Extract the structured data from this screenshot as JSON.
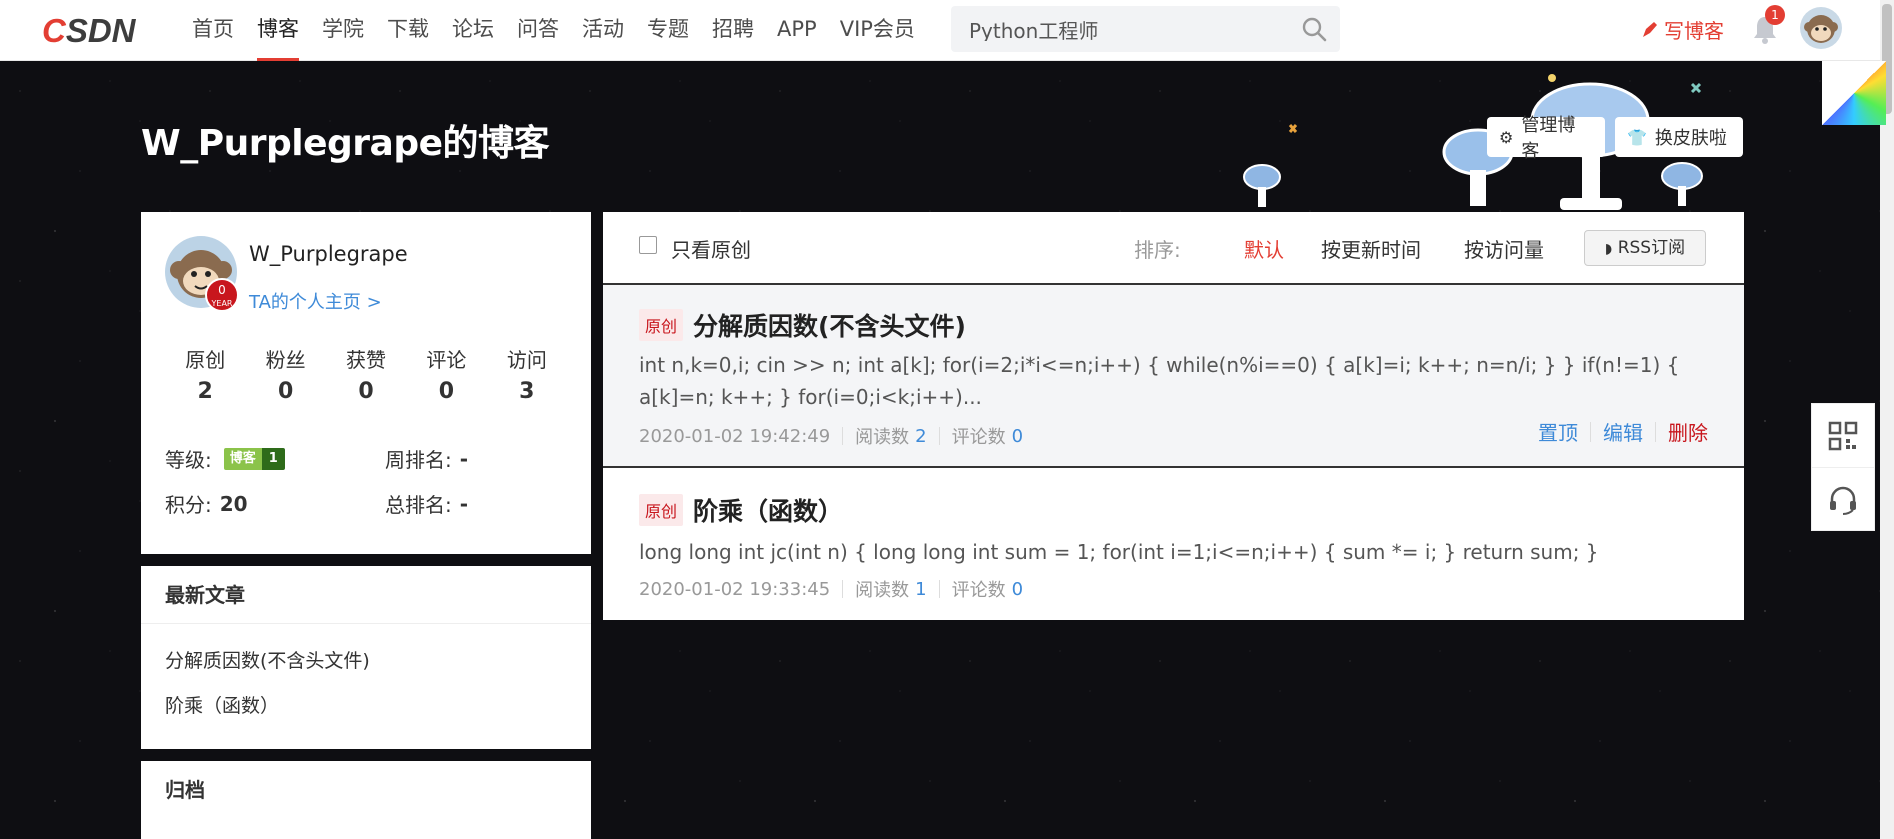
{
  "topbar": {
    "logo_text_red": "C",
    "logo_text_dark": "SDN",
    "nav": [
      "首页",
      "博客",
      "学院",
      "下载",
      "论坛",
      "问答",
      "活动",
      "专题",
      "招聘",
      "APP",
      "VIP会员"
    ],
    "active_nav": "博客",
    "search_value": "Python工程师",
    "write_blog_label": "写博客",
    "notification_count": "1"
  },
  "banner": {
    "blog_title": "W_Purplegrape的博客",
    "manage_label": "管理博客",
    "skin_label": "换皮肤啦"
  },
  "profile": {
    "name": "W_Purplegrape",
    "homepage_link": "TA的个人主页 >",
    "year_badge": "0",
    "year_badge_sub": "YEAR",
    "stats": [
      {
        "label": "原创",
        "value": "2"
      },
      {
        "label": "粉丝",
        "value": "0"
      },
      {
        "label": "获赞",
        "value": "0"
      },
      {
        "label": "评论",
        "value": "0"
      },
      {
        "label": "访问",
        "value": "3"
      }
    ],
    "level_label": "等级:",
    "level_badge_text": "博客",
    "level_badge_num": "1",
    "points_label": "积分:",
    "points_value": "20",
    "week_rank_label": "周排名:",
    "week_rank_value": "-",
    "total_rank_label": "总排名:",
    "total_rank_value": "-"
  },
  "recent": {
    "heading": "最新文章",
    "items": [
      "分解质因数(不含头文件)",
      "阶乘（函数）"
    ]
  },
  "archive": {
    "heading": "归档"
  },
  "filter": {
    "only_original_label": "只看原创",
    "sort_label": "排序:",
    "sort_options": [
      "默认",
      "按更新时间",
      "按访问量"
    ],
    "active_sort": "默认",
    "rss_label": "RSS订阅"
  },
  "articles": [
    {
      "tag": "原创",
      "title": "分解质因数(不含头文件)",
      "desc": "int n,k=0,i; cin >> n; int a[k]; for(i=2;i*i<=n;i++) { while(n%i==0) { a[k]=i; k++; n=n/i; } } if(n!=1) { a[k]=n; k++; } for(i=0;i<k;i++)...",
      "date": "2020-01-02 19:42:49",
      "reads_label": "阅读数",
      "reads": "2",
      "comments_label": "评论数",
      "comments": "0",
      "ops": [
        "置顶",
        "编辑",
        "删除"
      ]
    },
    {
      "tag": "原创",
      "title": "阶乘（函数）",
      "desc": "long long int jc(int n) { long long int sum = 1; for(int i=1;i<=n;i++) { sum *= i; } return sum; }",
      "date": "2020-01-02 19:33:45",
      "reads_label": "阅读数",
      "reads": "1",
      "comments_label": "评论数",
      "comments": "0"
    }
  ],
  "colors": {
    "accent": "#e33e33",
    "link": "#3e8ad8",
    "level_green": "#8bc34a"
  }
}
